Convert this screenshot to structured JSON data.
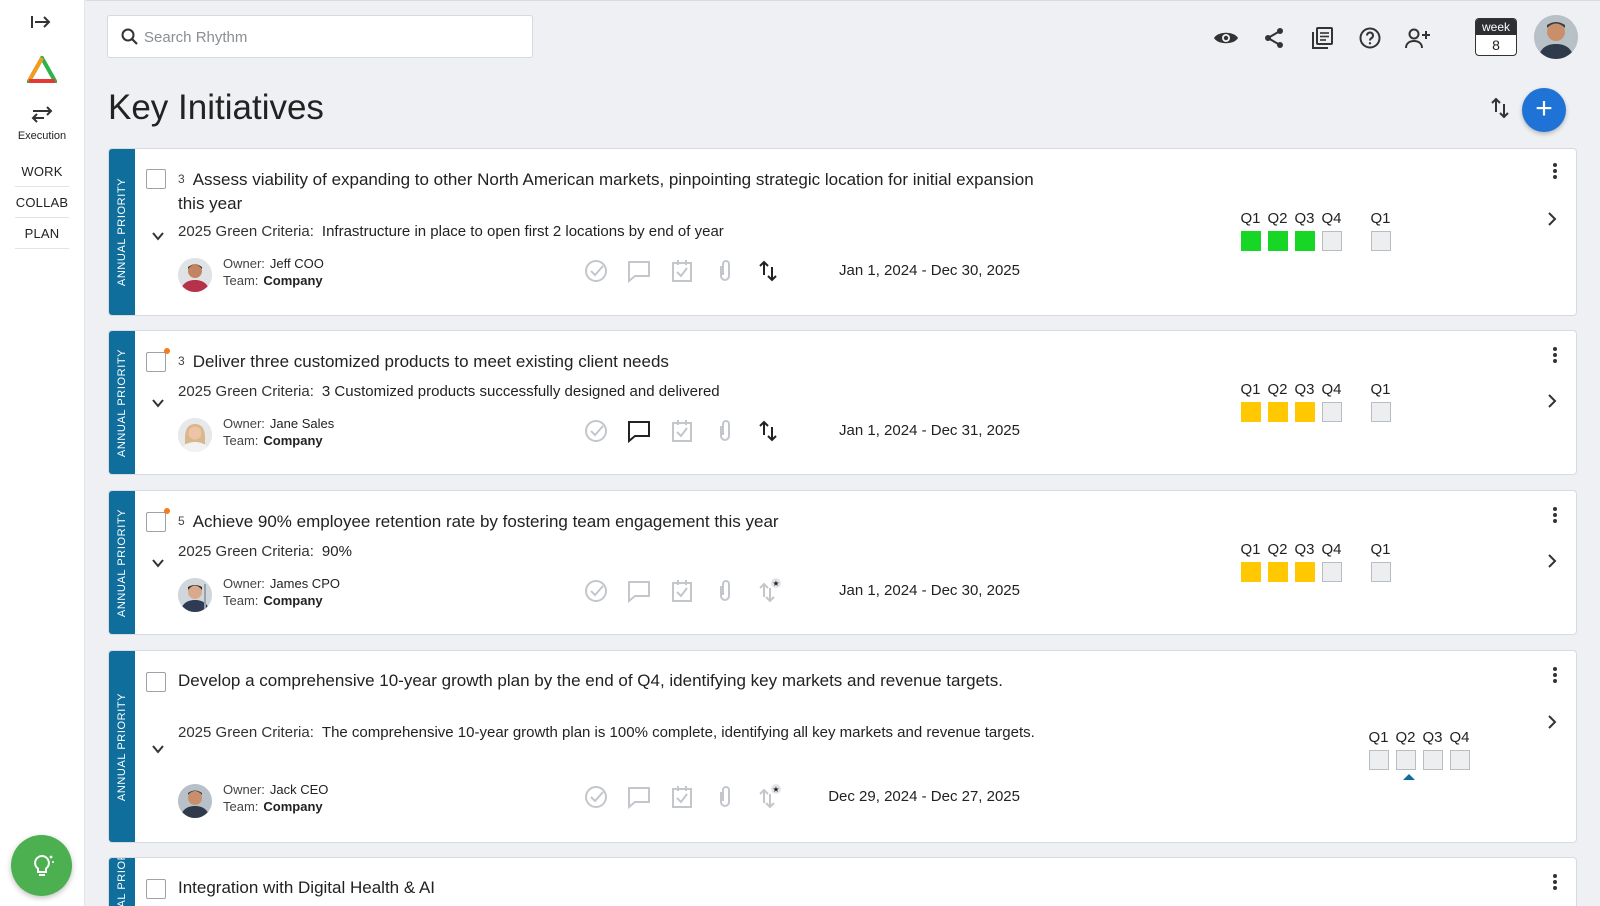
{
  "app": {
    "search_placeholder": "Search Rhythm",
    "week_label": "week",
    "week_number": "8",
    "rail": {
      "execution_label": "Execution",
      "nav": [
        "WORK",
        "COLLAB",
        "PLAN"
      ]
    },
    "page_title": "Key Initiatives"
  },
  "colors": {
    "stripe": "#0f6e9c",
    "green": "#17d626",
    "yellow": "#ffc800",
    "accent": "#1f73d6"
  },
  "initiatives": [
    {
      "category": "ANNUAL PRIORITY",
      "number": "3",
      "title": "Assess viability of expanding to other North American markets, pinpointing strategic location for initial expansion this year",
      "criteria_label": "2025 Green Criteria:",
      "criteria": "Infrastructure in place to open first 2 locations by end of year",
      "owner_label": "Owner:",
      "owner": "Jeff COO",
      "team_label": "Team:",
      "team": "Company",
      "dates": "Jan 1, 2024 - Dec 30, 2025",
      "quarters": [
        "Q1",
        "Q2",
        "Q3",
        "Q4"
      ],
      "next_quarter": "Q1",
      "status": [
        "green",
        "green",
        "green",
        "empty"
      ]
    },
    {
      "category": "ANNUAL PRIORITY",
      "number": "3",
      "title": "Deliver three customized products to meet existing client needs",
      "criteria_label": "2025 Green Criteria:",
      "criteria": "3 Customized products successfully designed and delivered",
      "owner_label": "Owner:",
      "owner": "Jane Sales",
      "team_label": "Team:",
      "team": "Company",
      "dates": "Jan 1, 2024 - Dec 31, 2025",
      "quarters": [
        "Q1",
        "Q2",
        "Q3",
        "Q4"
      ],
      "next_quarter": "Q1",
      "status": [
        "yellow",
        "yellow",
        "yellow",
        "empty"
      ]
    },
    {
      "category": "ANNUAL PRIORITY",
      "number": "5",
      "title": "Achieve 90% employee retention rate by fostering team engagement this year",
      "criteria_label": "2025 Green Criteria:",
      "criteria": "90%",
      "owner_label": "Owner:",
      "owner": "James CPO",
      "team_label": "Team:",
      "team": "Company",
      "dates": "Jan 1, 2024 - Dec 30, 2025",
      "quarters": [
        "Q1",
        "Q2",
        "Q3",
        "Q4"
      ],
      "next_quarter": "Q1",
      "status": [
        "yellow",
        "yellow",
        "yellow",
        "empty"
      ]
    },
    {
      "category": "ANNUAL PRIORITY",
      "number": "",
      "title": "Develop a comprehensive 10-year growth plan by the end of Q4, identifying key markets and revenue targets.",
      "criteria_label": "2025 Green Criteria:",
      "criteria": "The comprehensive 10-year growth plan is 100% complete, identifying all key markets and revenue targets.",
      "owner_label": "Owner:",
      "owner": "Jack CEO",
      "team_label": "Team:",
      "team": "Company",
      "dates": "Dec 29, 2024 - Dec 27, 2025",
      "quarters": [
        "Q1",
        "Q2",
        "Q3",
        "Q4"
      ],
      "status": [
        "empty",
        "empty",
        "empty",
        "empty"
      ]
    },
    {
      "category": "ANNUAL PRIORITY",
      "title": "Integration with Digital Health & AI"
    }
  ]
}
